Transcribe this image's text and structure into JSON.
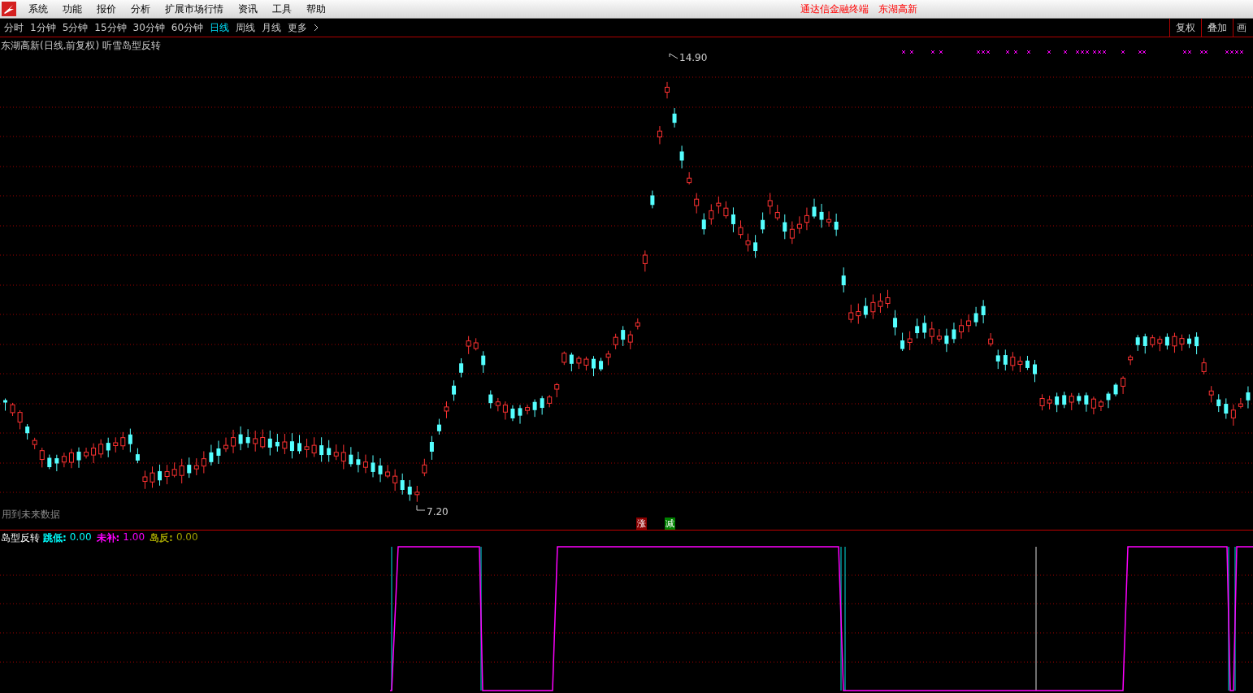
{
  "menu": [
    "系统",
    "功能",
    "报价",
    "分析",
    "扩展市场行情",
    "资讯",
    "工具",
    "帮助"
  ],
  "brand": "通达信金融终端",
  "stock_name": "东湖高新",
  "periods": [
    {
      "label": "分时",
      "selected": false
    },
    {
      "label": "1分钟",
      "selected": false
    },
    {
      "label": "5分钟",
      "selected": false
    },
    {
      "label": "15分钟",
      "selected": false
    },
    {
      "label": "30分钟",
      "selected": false
    },
    {
      "label": "60分钟",
      "selected": false
    },
    {
      "label": "日线",
      "selected": true
    },
    {
      "label": "周线",
      "selected": false
    },
    {
      "label": "月线",
      "selected": false
    },
    {
      "label": "更多",
      "selected": false
    }
  ],
  "right_tools": [
    "复权",
    "叠加",
    "画"
  ],
  "chart": {
    "title": "东湖高新(日线.前复权) 听雪岛型反转",
    "high_label": "14.90",
    "low_label": "7.20",
    "note": "用到未来数据",
    "marks": [
      {
        "text": "涨",
        "color": "#8b0000"
      },
      {
        "text": "减",
        "color": "#008000"
      }
    ]
  },
  "indicator": {
    "name": "岛型反转",
    "values": [
      {
        "label": "跳低:",
        "value": "0.00",
        "color": "#00ffff"
      },
      {
        "label": "未补:",
        "value": "1.00",
        "color": "#ff00ff"
      },
      {
        "label": "岛反:",
        "value": "0.00",
        "color": "#a0a000"
      }
    ]
  }
}
